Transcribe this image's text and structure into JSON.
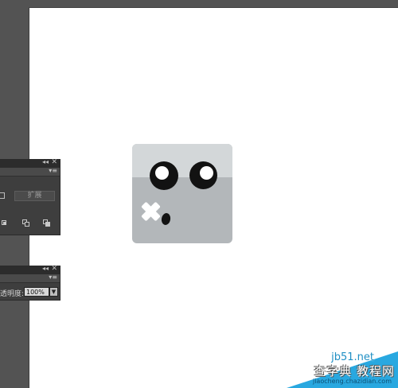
{
  "transform_panel": {
    "collapse_icon": "double-chevron-left",
    "close_icon": "close-x",
    "menu_icon": "panel-menu",
    "expand_label": "扩展"
  },
  "transparency_panel": {
    "collapse_icon": "double-chevron-left",
    "close_icon": "close-x",
    "menu_icon": "panel-menu",
    "opacity_label": "透明度:",
    "opacity_value": "100%"
  },
  "artwork": {
    "upper_color": "#d3d7d9",
    "lower_color": "#b3b7ba",
    "eye_color": "#121212",
    "pupil_color": "#ffffff"
  },
  "watermark": {
    "site": "jb51.net",
    "title": "查字典 教程网",
    "domain": "jiaocheng.chazidian.com",
    "accent_color": "#29a8e0"
  }
}
